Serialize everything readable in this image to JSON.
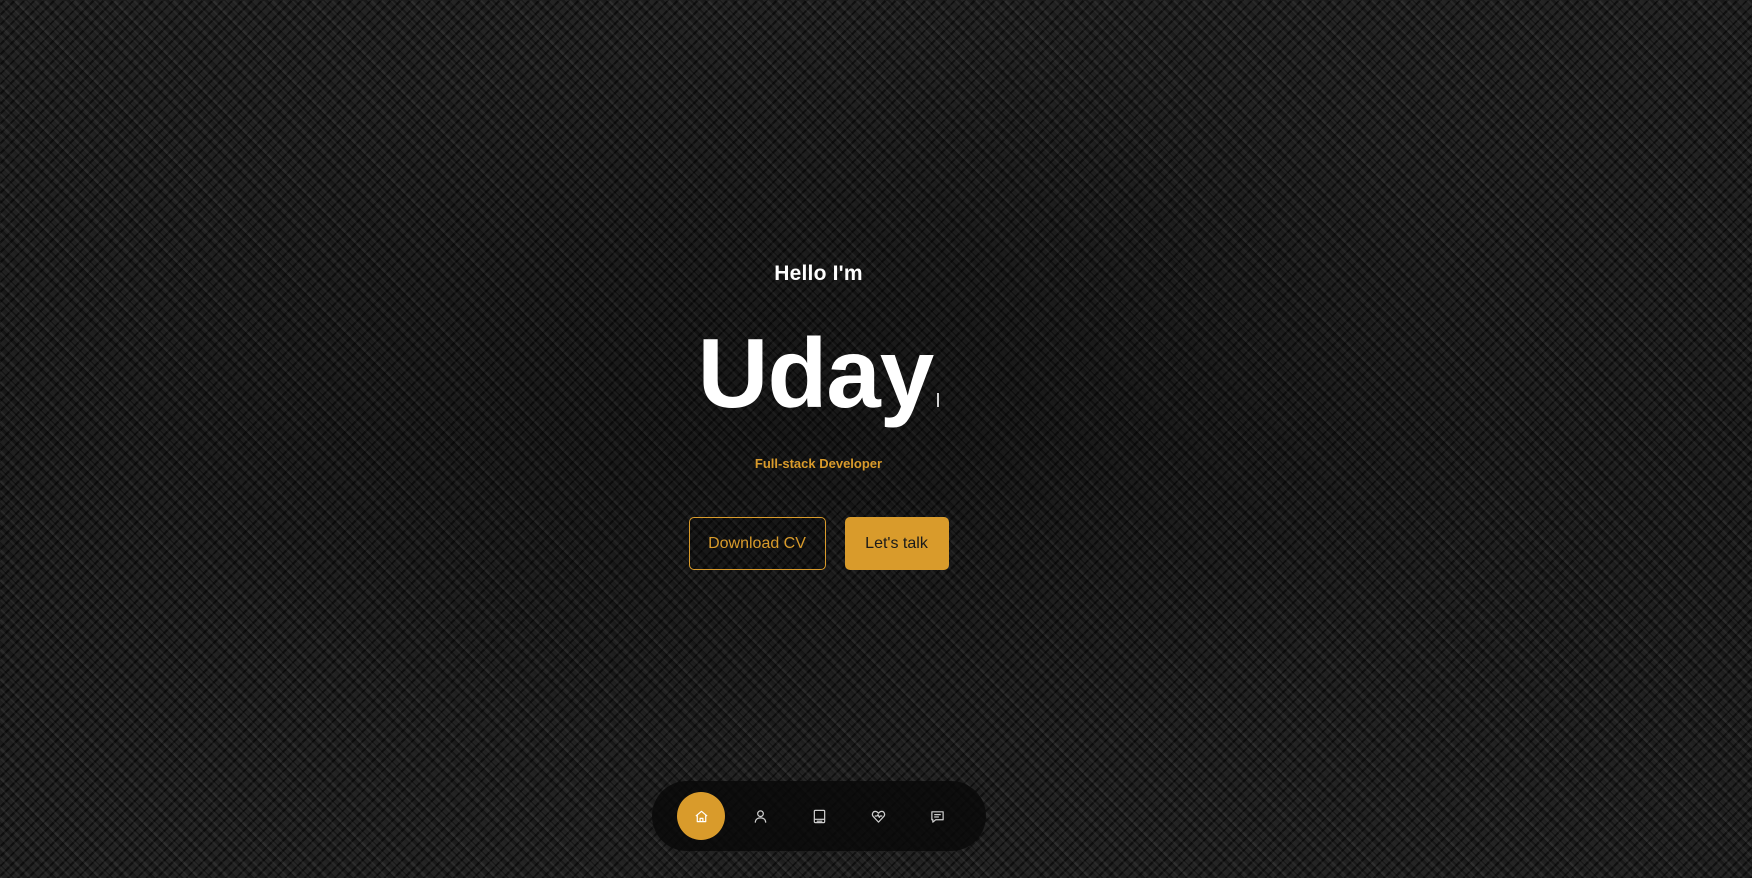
{
  "hero": {
    "greeting": "Hello I'm",
    "name": "Uday",
    "role": "Full-stack Developer"
  },
  "buttons": {
    "download_cv": "Download CV",
    "lets_talk": "Let's talk"
  },
  "nav": {
    "items": [
      {
        "icon": "home-icon",
        "active": true
      },
      {
        "icon": "user-icon",
        "active": false
      },
      {
        "icon": "book-icon",
        "active": false
      },
      {
        "icon": "services-icon",
        "active": false
      },
      {
        "icon": "message-icon",
        "active": false
      }
    ]
  },
  "colors": {
    "accent": "#d99b2b",
    "text": "#ffffff",
    "background": "#141414"
  }
}
